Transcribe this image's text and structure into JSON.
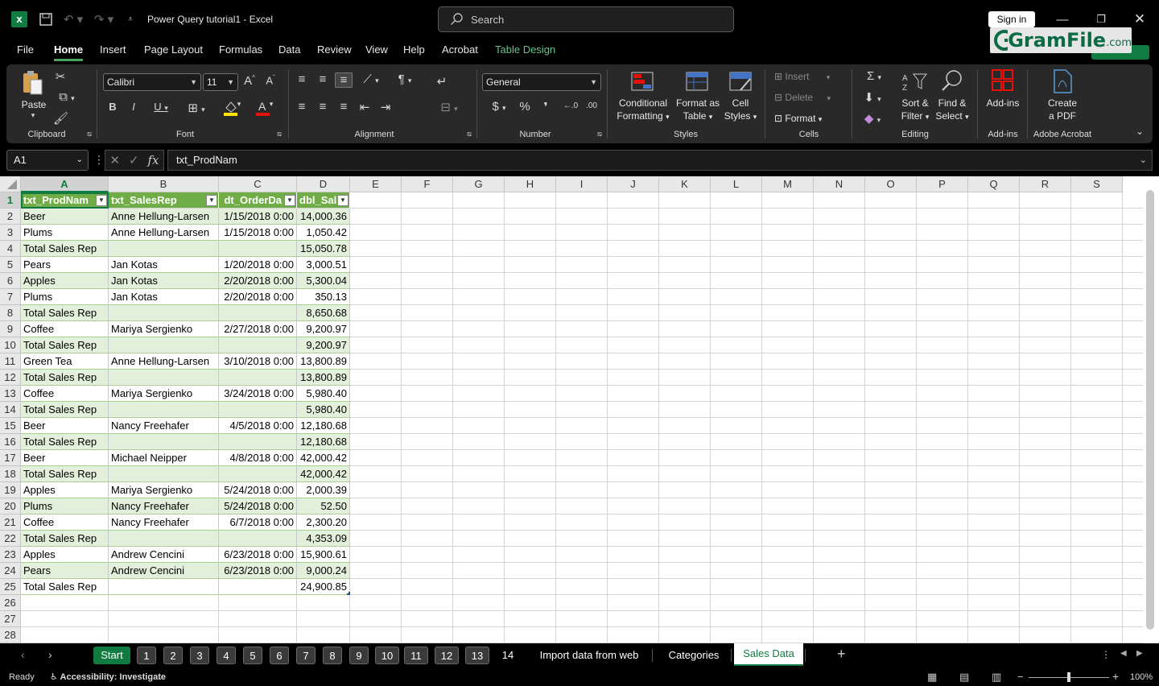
{
  "titlebar": {
    "doc_title": "Power Query tutorial1  -  Excel",
    "search_placeholder": "Search",
    "signin": "Sign in",
    "watermark_main": "GramFile",
    "watermark_suffix": ".com"
  },
  "menu": {
    "tabs": [
      {
        "label": "File"
      },
      {
        "label": "Home"
      },
      {
        "label": "Insert"
      },
      {
        "label": "Page Layout"
      },
      {
        "label": "Formulas"
      },
      {
        "label": "Data"
      },
      {
        "label": "Review"
      },
      {
        "label": "View"
      },
      {
        "label": "Help"
      },
      {
        "label": "Acrobat"
      },
      {
        "label": "Table Design"
      }
    ]
  },
  "ribbon": {
    "paste": "Paste",
    "clipboard": "Clipboard",
    "font_name": "Calibri",
    "font_size": "11",
    "font": "Font",
    "alignment": "Alignment",
    "number_format": "General",
    "number": "Number",
    "cond_fmt_1": "Conditional",
    "cond_fmt_2": "Formatting",
    "fmt_table_1": "Format as",
    "fmt_table_2": "Table",
    "cell_styles_1": "Cell",
    "cell_styles_2": "Styles",
    "styles": "Styles",
    "insert": "Insert",
    "delete": "Delete",
    "format": "Format",
    "cells": "Cells",
    "sort_1": "Sort &",
    "sort_2": "Filter",
    "find_1": "Find &",
    "find_2": "Select",
    "editing": "Editing",
    "addins": "Add-ins",
    "addins_grp": "Add-ins",
    "pdf_1": "Create",
    "pdf_2": "a PDF",
    "acrobat": "Adobe Acrobat"
  },
  "formula_bar": {
    "name_box": "A1",
    "formula": "txt_ProdNam"
  },
  "grid": {
    "columns": [
      "A",
      "B",
      "C",
      "D",
      "E",
      "F",
      "G",
      "H",
      "I",
      "J",
      "K",
      "L",
      "M",
      "N",
      "O",
      "P",
      "Q",
      "R",
      "S"
    ],
    "rows": [
      [
        "txt_ProdNam",
        "txt_SalesRep",
        "dt_OrderDa",
        "dbl_Sal"
      ],
      [
        "Beer",
        "Anne Hellung-Larsen",
        "1/15/2018 0:00",
        "14,000.36"
      ],
      [
        "Plums",
        "Anne Hellung-Larsen",
        "1/15/2018 0:00",
        "1,050.42"
      ],
      [
        "  Total Sales Rep",
        "",
        "",
        "15,050.78"
      ],
      [
        "Pears",
        "Jan Kotas",
        "1/20/2018 0:00",
        "3,000.51"
      ],
      [
        "Apples",
        "Jan Kotas",
        "2/20/2018 0:00",
        "5,300.04"
      ],
      [
        "Plums",
        "Jan Kotas",
        "2/20/2018 0:00",
        "350.13"
      ],
      [
        "  Total Sales Rep",
        "",
        "",
        "8,650.68"
      ],
      [
        "Coffee",
        "Mariya Sergienko",
        "2/27/2018 0:00",
        "9,200.97"
      ],
      [
        "  Total Sales Rep",
        "",
        "",
        "9,200.97"
      ],
      [
        "Green Tea",
        "Anne Hellung-Larsen",
        "3/10/2018 0:00",
        "13,800.89"
      ],
      [
        "  Total Sales Rep",
        "",
        "",
        "13,800.89"
      ],
      [
        "Coffee",
        "Mariya Sergienko",
        "3/24/2018 0:00",
        "5,980.40"
      ],
      [
        "  Total Sales Rep",
        "",
        "",
        "5,980.40"
      ],
      [
        "Beer",
        "Nancy Freehafer",
        "4/5/2018 0:00",
        "12,180.68"
      ],
      [
        "  Total Sales Rep",
        "",
        "",
        "12,180.68"
      ],
      [
        "Beer",
        "Michael Neipper",
        "4/8/2018 0:00",
        "42,000.42"
      ],
      [
        "  Total Sales Rep",
        "",
        "",
        "42,000.42"
      ],
      [
        "Apples",
        "Mariya Sergienko",
        "5/24/2018 0:00",
        "2,000.39"
      ],
      [
        "Plums",
        "Nancy Freehafer",
        "5/24/2018 0:00",
        "52.50"
      ],
      [
        "Coffee",
        "Nancy Freehafer",
        "6/7/2018 0:00",
        "2,300.20"
      ],
      [
        "  Total Sales Rep",
        "",
        "",
        "4,353.09"
      ],
      [
        "Apples",
        "Andrew Cencini",
        "6/23/2018 0:00",
        "15,900.61"
      ],
      [
        "Pears",
        "Andrew Cencini",
        "6/23/2018 0:00",
        "9,000.24"
      ],
      [
        "  Total Sales Rep",
        "",
        "",
        "24,900.85"
      ],
      [
        "",
        "",
        "",
        ""
      ],
      [
        "",
        "",
        "",
        ""
      ],
      [
        "",
        "",
        "",
        ""
      ]
    ],
    "row_numbers": [
      "1",
      "2",
      "3",
      "4",
      "5",
      "6",
      "7",
      "8",
      "9",
      "10",
      "11",
      "12",
      "13",
      "14",
      "15",
      "16",
      "17",
      "18",
      "19",
      "20",
      "21",
      "22",
      "23",
      "24",
      "25",
      "26",
      "27",
      "28"
    ]
  },
  "sheets": {
    "tabs": [
      "Start",
      "1",
      "2",
      "3",
      "4",
      "5",
      "6",
      "7",
      "8",
      "9",
      "10",
      "11",
      "12",
      "13",
      "14",
      "Import data from web",
      "Categories",
      "Sales Data"
    ],
    "add": "+"
  },
  "status": {
    "ready": "Ready",
    "accessibility": "Accessibility: Investigate",
    "zoom": "100%"
  },
  "colors": {
    "header_green": "#70ad47",
    "band": "#e2efda",
    "accent": "#107c41"
  }
}
